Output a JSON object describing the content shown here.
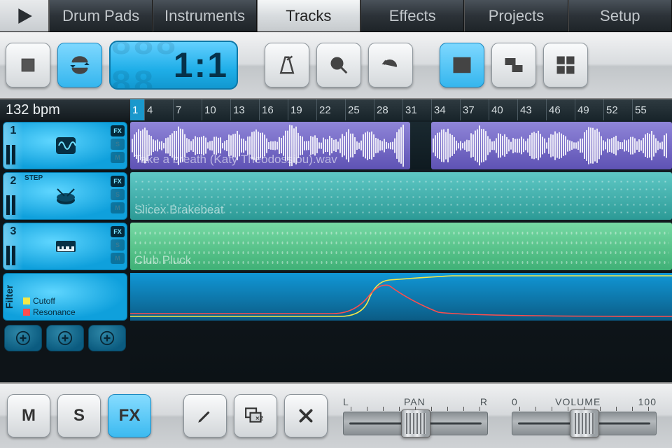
{
  "tabs": [
    "Drum Pads",
    "Instruments",
    "Tracks",
    "Effects",
    "Projects",
    "Setup"
  ],
  "active_tab": 2,
  "transport": {
    "position": "1:1"
  },
  "tempo": {
    "bpm_label": "132 bpm"
  },
  "ruler": [
    "1",
    "4",
    "7",
    "10",
    "13",
    "16",
    "19",
    "22",
    "25",
    "28",
    "31",
    "34",
    "37",
    "40",
    "43",
    "46",
    "49",
    "52",
    "55"
  ],
  "tracks": [
    {
      "num": "1",
      "type": "audio",
      "clip_label": "Take a breath (Katy Theodossiou).wav",
      "fx": true,
      "solo": false,
      "mute": false,
      "clips": [
        {
          "start": 0,
          "len": 400
        },
        {
          "start": 430,
          "len": 344
        }
      ]
    },
    {
      "num": "2",
      "type": "step",
      "step_tag": "STEP",
      "clip_label": "Slicex Brakebeat",
      "fx": true,
      "solo": false,
      "mute": false,
      "clips": [
        {
          "start": 0,
          "len": 774
        }
      ]
    },
    {
      "num": "3",
      "type": "keys",
      "clip_label": "Club Pluck",
      "fx": true,
      "solo": false,
      "mute": false,
      "clips": [
        {
          "start": 0,
          "len": 774
        }
      ]
    }
  ],
  "automation": {
    "title": "Filter",
    "params": [
      {
        "name": "Cutoff",
        "color": "#f5e848"
      },
      {
        "name": "Resonance",
        "color": "#ff4d4d"
      }
    ]
  },
  "bottom": {
    "mute": "M",
    "solo": "S",
    "fx": "FX",
    "dup": "×2",
    "pan": {
      "left": "L",
      "label": "PAN",
      "right": "R",
      "value": 0.5
    },
    "vol": {
      "min": "0",
      "label": "VOLUME",
      "max": "100",
      "value": 0.5
    }
  }
}
